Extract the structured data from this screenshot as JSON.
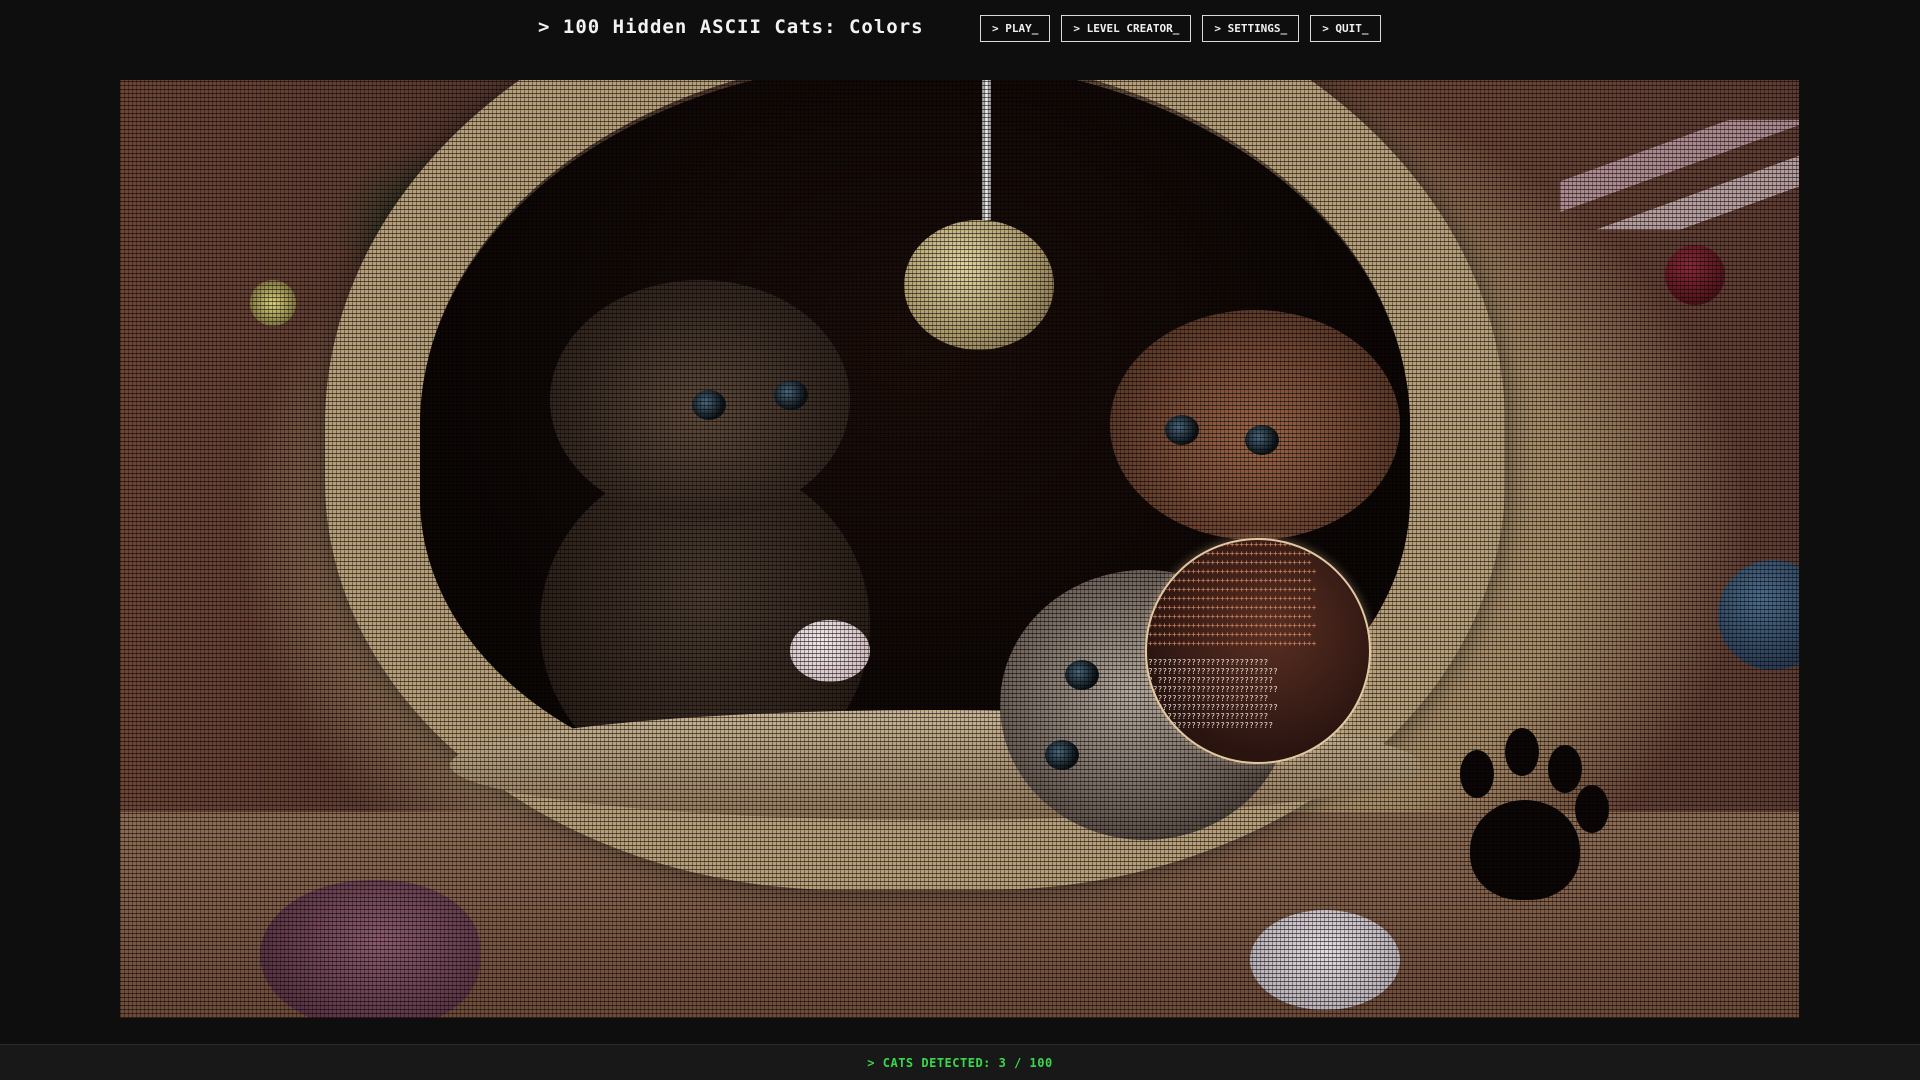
{
  "app": {
    "title": "> 100 Hidden ASCII Cats: Colors"
  },
  "menu": {
    "items": [
      {
        "label": "> PLAY_"
      },
      {
        "label": "> LEVEL CREATOR_"
      },
      {
        "label": "> SETTINGS_"
      },
      {
        "label": "> QUIT_"
      }
    ]
  },
  "status": {
    "text": "> CATS DETECTED: 3 / 100",
    "detected": 3,
    "total": 100,
    "color": "#39d84a"
  },
  "scene": {
    "magnifier_color": "#e3c9a2"
  }
}
